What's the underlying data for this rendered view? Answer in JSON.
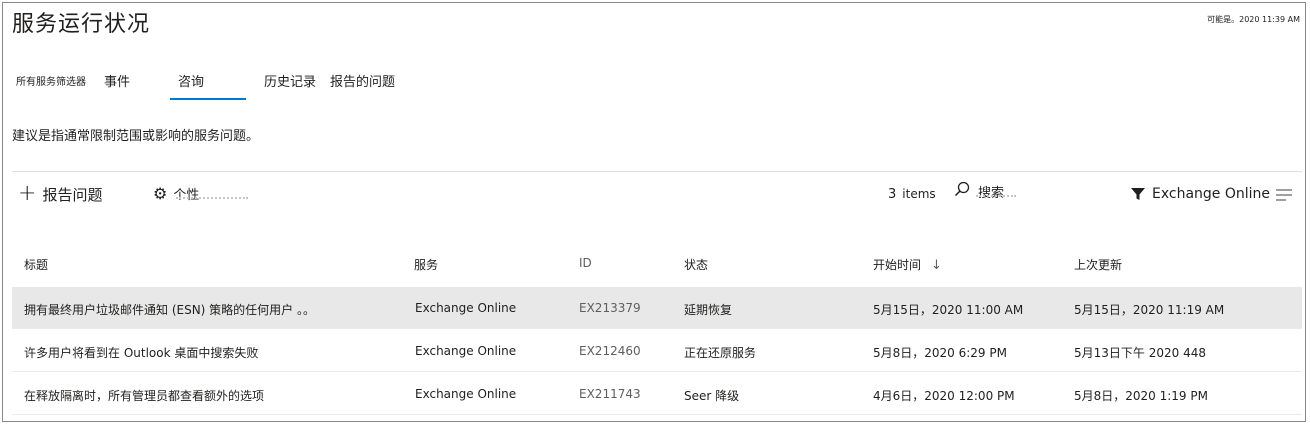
{
  "page": {
    "title": "服务运行状况",
    "status_text": "可能是。2020 11:39 AM"
  },
  "tabs": {
    "filter_label": "所有服务筛选器",
    "items": [
      "事件",
      "咨询",
      "历史记录",
      "报告的问题"
    ],
    "active": "咨询"
  },
  "description": "建议是指通常限制范围或影响的服务问题。",
  "toolbar": {
    "report_label": "报告问题",
    "personalize_label": "个性",
    "count_value": "3",
    "count_unit": "items",
    "search_label": "搜索",
    "filter_value": "Exchange Online",
    "icons": [
      "plus-icon",
      "gear-icon",
      "search-icon",
      "filter-icon",
      "list-icon"
    ]
  },
  "table": {
    "headers": [
      "标题",
      "服务",
      "ID",
      "状态",
      "开始时间",
      "上次更新"
    ],
    "sort_indicator": "↓",
    "rows": [
      {
        "title": "拥有最终用户垃圾邮件通知 (ESN) 策略的任何用户 。。",
        "service": "Exchange Online",
        "id": "EX213379",
        "status": "延期恢复",
        "start": "5月15日，2020 11:00 AM",
        "updated": "5月15日，2020 11:19 AM"
      },
      {
        "title": "许多用户将看到在 Outlook 桌面中搜索失败",
        "service": "Exchange Online",
        "id": "EX212460",
        "status": "正在还原服务",
        "start": "5月8日，2020 6:29 PM",
        "updated": "5月13日下午 2020 448"
      },
      {
        "title": "在释放隔离时，所有管理员都查看额外的选项",
        "service": "Exchange Online",
        "id": "EX211743",
        "status": "Seer 降级",
        "start": "4月6日，2020 12:00 PM",
        "updated": "5月8日，2020 1:19 PM"
      }
    ]
  },
  "colors": {
    "accent": "#0078d4",
    "selected_row": "#e8e8e8",
    "border": "#8a8886"
  }
}
